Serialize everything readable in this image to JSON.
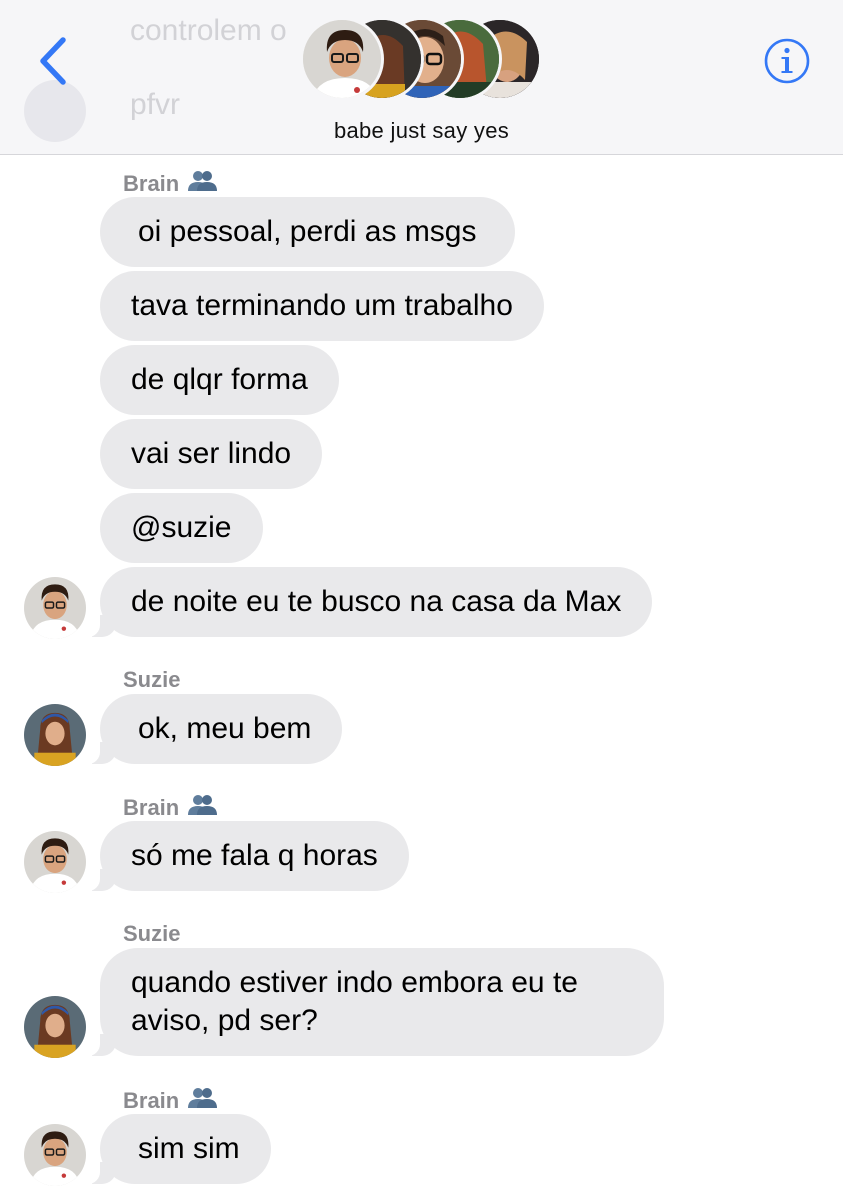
{
  "header": {
    "background_ghost_text_1": "controlem o",
    "background_ghost_text_2": "pfvr",
    "group_title": "babe just say yes",
    "back_icon": "chevron-left-icon",
    "info_icon": "info-circle-icon",
    "accent_color": "#3478f6"
  },
  "messages": {
    "m1_sender": "Brain",
    "m1_b1": "oi pessoal, perdi as msgs",
    "m1_b2": "tava terminando um trabalho",
    "m1_b3": "de qlqr forma",
    "m1_b4": "vai ser lindo",
    "m1_b5": "@suzie",
    "m1_b6": "de noite eu te busco na casa da Max",
    "m2_sender": "Suzie",
    "m2_b1": "ok, meu bem",
    "m3_sender": "Brain",
    "m3_b1": "só me fala q horas",
    "m4_sender": "Suzie",
    "m4_b1": "quando estiver indo embora eu te aviso, pd ser?",
    "m5_sender": "Brain",
    "m5_b1": "sim sim"
  },
  "colors": {
    "bubble_gray": "#e9e9eb",
    "sender_gray": "#8a8a8e",
    "friends_icon_blue": "#5f7d9c"
  }
}
